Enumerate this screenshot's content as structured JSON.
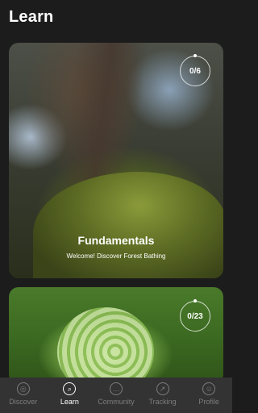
{
  "page": {
    "title": "Learn"
  },
  "cards": [
    {
      "progress": "0/6",
      "title": "Fundamentals",
      "subtitle": "Welcome!  Discover Forest Bathing"
    },
    {
      "progress": "0/23"
    }
  ],
  "nav": [
    {
      "label": "Discover",
      "icon": "compass-icon"
    },
    {
      "label": "Learn",
      "icon": "search-icon",
      "active": true
    },
    {
      "label": "Community",
      "icon": "chat-icon"
    },
    {
      "label": "Tracking",
      "icon": "chart-icon"
    },
    {
      "label": "Profile",
      "icon": "user-icon"
    }
  ]
}
